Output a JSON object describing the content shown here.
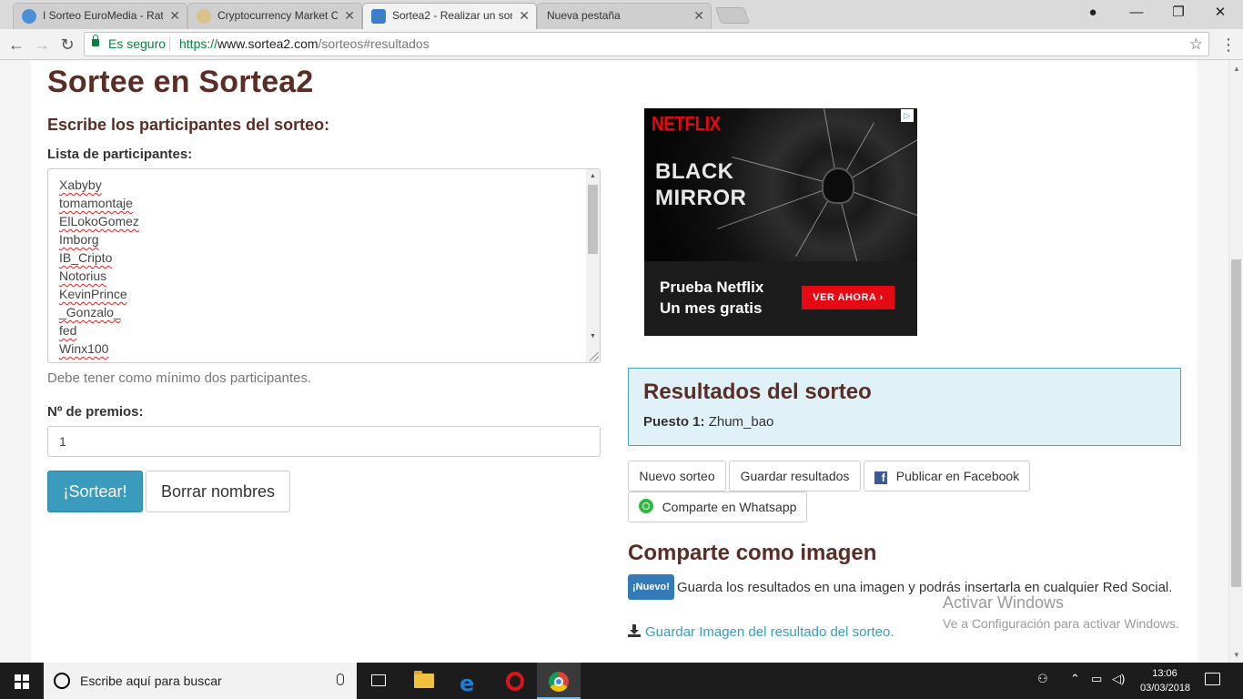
{
  "browser": {
    "tabs": [
      {
        "title": "I Sorteo EuroMedia - Rat",
        "active": false
      },
      {
        "title": "Cryptocurrency Market C",
        "active": false
      },
      {
        "title": "Sortea2 - Realizar un sor",
        "active": true
      },
      {
        "title": "Nueva pestaña",
        "active": false
      }
    ],
    "secure_label": "Es seguro",
    "url_scheme": "https://",
    "url_host": "www.sortea2.com",
    "url_path": "/sorteos#resultados"
  },
  "page": {
    "title": "Sortee en Sortea2",
    "subtitle": "Escribe los participantes del sorteo:",
    "participants_label": "Lista de participantes:",
    "participants": [
      "Xabyby",
      "tomamontaje",
      "ElLokoGomez",
      "Imborg",
      "IB_Cripto",
      "Notorius",
      "KevinPrince",
      "_Gonzalo_",
      "fed",
      "Winx100"
    ],
    "participants_help": "Debe tener como mínimo dos participantes.",
    "prizes_label": "Nº de premios:",
    "prizes_value": "1",
    "draw_button": "¡Sortear!",
    "clear_button": "Borrar nombres"
  },
  "ad": {
    "brand": "NETFLIX",
    "show_line1": "BLACK",
    "show_line2": "MIRROR",
    "cta_line1": "Prueba Netflix",
    "cta_line2": "Un mes gratis",
    "cta_button": "VER AHORA"
  },
  "results": {
    "title": "Resultados del sorteo",
    "position_label": "Puesto 1:",
    "winner": "Zhum_bao",
    "buttons": {
      "new_draw": "Nuevo sorteo",
      "save": "Guardar resultados",
      "facebook": "Publicar en Facebook",
      "whatsapp": "Comparte en Whatsapp"
    }
  },
  "share": {
    "title": "Comparte como imagen",
    "badge": "¡Nuevo!",
    "text": "Guarda los resultados en una imagen y podrás insertarla en cualquier Red Social.",
    "download_link": "Guardar Imagen del resultado del sorteo."
  },
  "watermark": {
    "line1": "Activar Windows",
    "line2": "Ve a Configuración para activar Windows."
  },
  "taskbar": {
    "search_placeholder": "Escribe aquí para buscar",
    "time": "13:06",
    "date": "03/03/2018"
  },
  "colors": {
    "heading": "#5a2d26",
    "primary": "#3a9bbd",
    "results_bg": "#e1f1f8",
    "netflix_red": "#e50914"
  }
}
